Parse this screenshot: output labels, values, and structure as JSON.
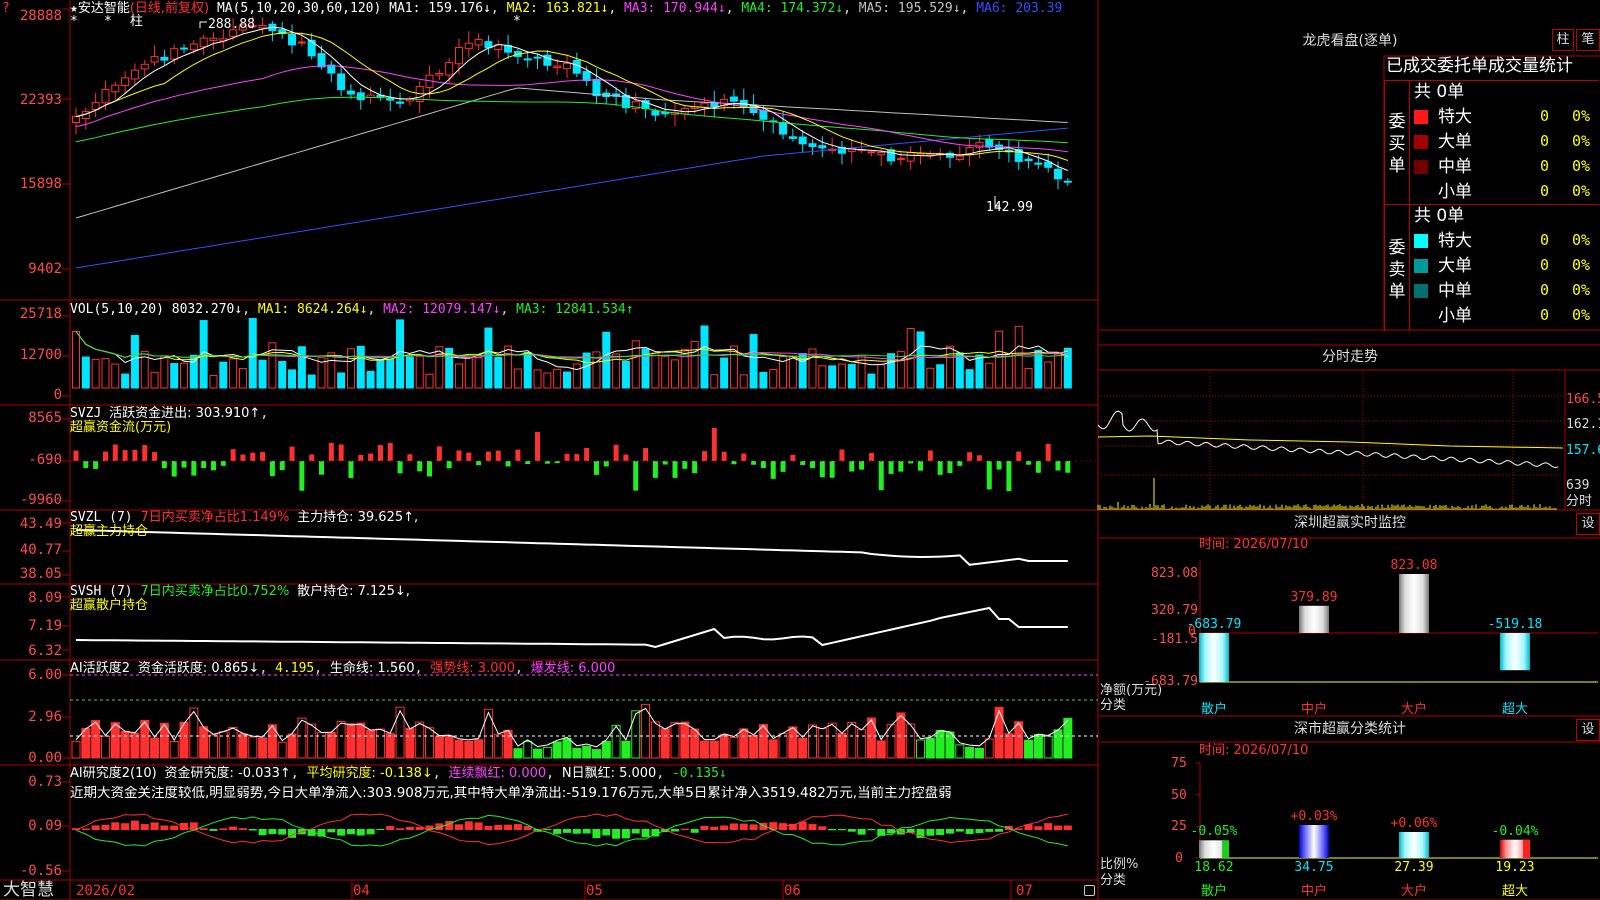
{
  "colors": {
    "up": "#ff3030",
    "down": "#00e5ff",
    "grid": "#b00000",
    "bg": "#000000",
    "green": "#22ee22",
    "yellow": "#ffff00"
  },
  "stock": {
    "star": "★",
    "name": "安达智能",
    "mode": "(日线,前复权)",
    "high_label": "288.88",
    "low_label": "142.99"
  },
  "price_panel": {
    "ma_title": "MA(5,10,20,30,60,120)",
    "ma": [
      {
        "label": "MA1: 159.176↓",
        "color": "#ffffff"
      },
      {
        "label": "MA2: 163.821↓",
        "color": "#ffff00"
      },
      {
        "label": "MA3: 170.944↓",
        "color": "#ff40ff"
      },
      {
        "label": "MA4: 174.372↓",
        "color": "#22ee22"
      },
      {
        "label": "MA5: 195.529↓",
        "color": "#c0c0c0"
      },
      {
        "label": "MA6: 203.39",
        "color": "#3050ff"
      }
    ],
    "y_labels": [
      "28888",
      "22393",
      "15898",
      "9402"
    ],
    "markers": [
      "?",
      "*",
      "柱"
    ]
  },
  "vol_panel": {
    "title": "VOL(5,10,20)",
    "value": "8032.270↓",
    "ma1": "MA1: 8624.264↓",
    "ma2": "MA2: 12079.147↓",
    "ma3": "MA3: 12841.534↑",
    "y_labels": [
      "25718",
      "12700",
      "0"
    ]
  },
  "svzj_panel": {
    "title": "SVZJ",
    "label": "活跃资金进出: 303.910↑",
    "sub": "超赢资金流(万元)",
    "y_labels": [
      "8565",
      "-690",
      "-9960"
    ]
  },
  "svzl_panel": {
    "title": "SVZL (7)",
    "net": "7日内买卖净占比1.149%",
    "hold": "主力持仓: 39.625↑,",
    "sub": "超赢主力持仓",
    "y_labels": [
      "43.49",
      "40.77",
      "38.05"
    ]
  },
  "svsh_panel": {
    "title": "SVSH (7)",
    "net": "7日内买卖净占比0.752%",
    "hold": "散户持仓: 7.125↓,",
    "sub": "超赢散户持仓",
    "y_labels": [
      "8.09",
      "7.19",
      "6.32"
    ]
  },
  "ai_active_panel": {
    "title": "AI活跃度2",
    "active": "资金活跃度: 0.865↓",
    "v2": "4.195",
    "life": "生命线: 1.560",
    "strong": "强势线: 3.000",
    "burst": "爆发线: 6.000",
    "y_labels": [
      "6.00",
      "2.96",
      "0.00"
    ]
  },
  "ai_research_panel": {
    "title": "AI研究度2(10)",
    "research": "资金研究度: -0.033↑",
    "avg": "平均研究度: -0.138↓",
    "red": "连续飘红: 0.000",
    "nred": "N日飘红: 5.000",
    "last": "-0.135↓",
    "comment": "近期大资金关注度较低,明显弱势,今日大单净流入:303.908万元,其中特大单净流出:-519.176万元,大单5日累计净入3519.482万元,当前主力控盘弱",
    "y_labels": [
      "0.73",
      "0.09",
      "-0.56"
    ]
  },
  "x_axis": {
    "brand": "大智慧",
    "dates": [
      "2026/02",
      "04",
      "05",
      "06",
      "07"
    ]
  },
  "dragon": {
    "title": "龙虎看盘(逐单)",
    "btn_bar": "柱",
    "btn_line": "笔",
    "header": "已成交委托单成交量统计",
    "buy": {
      "side": "委买单",
      "total": "共 0单",
      "rows": [
        {
          "name": "特大",
          "n": "0",
          "pct": "0%",
          "color": "#ff1a1a"
        },
        {
          "name": "大单",
          "n": "0",
          "pct": "0%",
          "color": "#a00000"
        },
        {
          "name": "中单",
          "n": "0",
          "pct": "0%",
          "color": "#700000"
        },
        {
          "name": "小单",
          "n": "0",
          "pct": "0%",
          "color": "#000000"
        }
      ]
    },
    "sell": {
      "side": "委卖单",
      "total": "共 0单",
      "rows": [
        {
          "name": "特大",
          "n": "0",
          "pct": "0%",
          "color": "#00ffff"
        },
        {
          "name": "大单",
          "n": "0",
          "pct": "0%",
          "color": "#009a9a"
        },
        {
          "name": "中单",
          "n": "0",
          "pct": "0%",
          "color": "#007070"
        },
        {
          "name": "小单",
          "n": "0",
          "pct": "0%",
          "color": "#000000"
        }
      ]
    }
  },
  "minute": {
    "title": "分时走势",
    "y_labels": [
      "166.5",
      "162.1",
      "157.6",
      "639",
      "分时"
    ]
  },
  "monitor": {
    "title": "深圳超赢实时监控",
    "set": "设",
    "time": "时间: 2026/07/10",
    "ylabel": "净额(万元)",
    "xlabel": "分类",
    "y_labels": [
      "823.08",
      "320.79",
      "-181.5",
      "-683.79"
    ],
    "zero": "0"
  },
  "stats": {
    "title": "深市超赢分类统计",
    "set": "设",
    "time": "时间: 2026/07/10",
    "ylabel": "比例%",
    "xlabel": "分类",
    "y_labels": [
      "75",
      "50",
      "25",
      "0"
    ]
  },
  "chart_data": [
    {
      "type": "bar",
      "title": "深圳超赢实时监控",
      "categories": [
        "散户",
        "中户",
        "大户",
        "超大"
      ],
      "values": [
        -683.79,
        379.89,
        823.08,
        -519.18
      ],
      "value_labels": [
        "-683.79",
        "379.89",
        "823.08",
        "-519.18"
      ],
      "ylim": [
        -683.79,
        823.08
      ]
    },
    {
      "type": "bar",
      "title": "深市超赢分类统计",
      "categories": [
        "散户",
        "中户",
        "大户",
        "超大"
      ],
      "values": [
        18.62,
        34.75,
        27.39,
        19.23
      ],
      "value_labels": [
        "18.62",
        "34.75",
        "27.39",
        "19.23"
      ],
      "changes": [
        "-0.05%",
        "+0.03%",
        "+0.06%",
        "-0.04%"
      ],
      "ylim": [
        0,
        75
      ]
    }
  ]
}
